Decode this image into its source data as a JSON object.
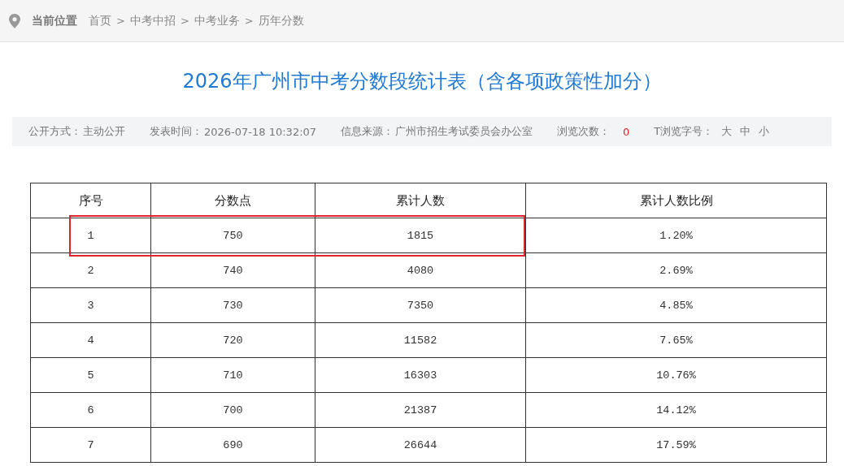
{
  "breadcrumb": {
    "label": "当前位置",
    "items": [
      {
        "kind": "link",
        "text": "首页"
      },
      {
        "kind": "separator",
        "text": ">"
      },
      {
        "kind": "link",
        "text": "中考中招"
      },
      {
        "kind": "separator",
        "text": ">"
      },
      {
        "kind": "link",
        "text": "中考业务"
      },
      {
        "kind": "separator",
        "text": ">"
      },
      {
        "kind": "link",
        "text": "历年分数"
      }
    ]
  },
  "title": "2026年广州市中考分数段统计表（含各项政策性加分）",
  "meta": [
    {
      "kind": "text",
      "label": "公开方式：",
      "value": "主动公开"
    },
    {
      "kind": "text",
      "label": "发表时间：",
      "value": "2026-07-18 10:32:07"
    },
    {
      "kind": "text",
      "label": "信息来源：",
      "value": "广州市招生考试委员会办公室"
    },
    {
      "kind": "count",
      "label": "浏览次数：",
      "value": "0"
    },
    {
      "kind": "sizes",
      "label": "T浏览字号：",
      "options": [
        "大",
        "中",
        "小"
      ]
    }
  ],
  "table": {
    "columns": [
      "序号",
      "分数点",
      "累计人数",
      "累计人数比例"
    ],
    "rows": [
      {
        "cells": [
          "1",
          "750",
          "1815",
          "1.20%"
        ],
        "highlighted": true
      },
      {
        "cells": [
          "2",
          "740",
          "4080",
          "2.69%"
        ],
        "highlighted": false
      },
      {
        "cells": [
          "3",
          "730",
          "7350",
          "4.85%"
        ],
        "highlighted": false
      },
      {
        "cells": [
          "4",
          "720",
          "11582",
          "7.65%"
        ],
        "highlighted": false
      },
      {
        "cells": [
          "5",
          "710",
          "16303",
          "10.76%"
        ],
        "highlighted": false
      },
      {
        "cells": [
          "6",
          "700",
          "21387",
          "14.12%"
        ],
        "highlighted": false
      },
      {
        "cells": [
          "7",
          "690",
          "26644",
          "17.59%"
        ],
        "highlighted": false
      }
    ]
  }
}
